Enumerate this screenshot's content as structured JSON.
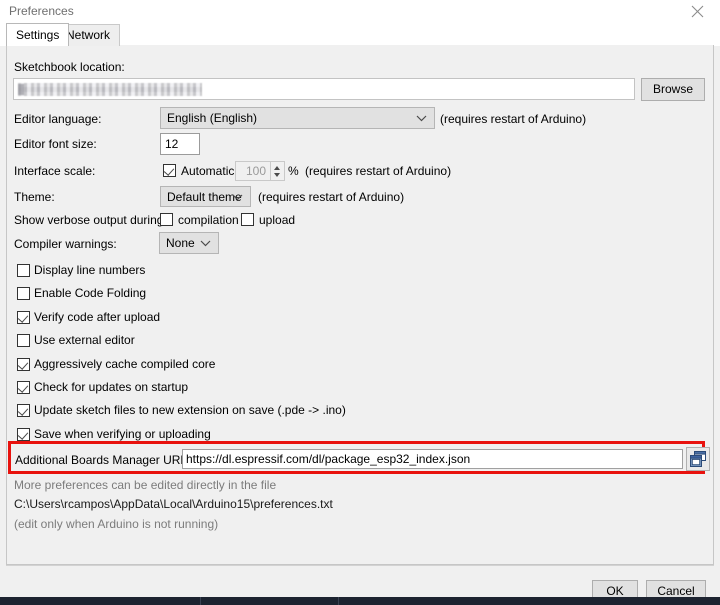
{
  "window": {
    "title": "Preferences",
    "close_icon": "close-icon"
  },
  "tabs": [
    {
      "label": "Settings",
      "active": true
    },
    {
      "label": "Network",
      "active": false
    }
  ],
  "settings": {
    "sketchbook": {
      "label": "Sketchbook location:",
      "value": "",
      "redacted": true,
      "browse_label": "Browse"
    },
    "editor_language": {
      "label": "Editor language:",
      "value": "English (English)",
      "note": "(requires restart of Arduino)"
    },
    "editor_font_size": {
      "label": "Editor font size:",
      "value": "12"
    },
    "interface_scale": {
      "label": "Interface scale:",
      "automatic_label": "Automatic",
      "automatic_checked": true,
      "scale_value": "100",
      "percent_symbol": "%",
      "note": "(requires restart of Arduino)"
    },
    "theme": {
      "label": "Theme:",
      "value": "Default theme",
      "note": "(requires restart of Arduino)"
    },
    "verbose_output": {
      "label": "Show verbose output during:",
      "options": [
        {
          "label": "compilation",
          "checked": false
        },
        {
          "label": "upload",
          "checked": false
        }
      ]
    },
    "compiler_warnings": {
      "label": "Compiler warnings:",
      "value": "None"
    },
    "checkbox_options": [
      {
        "label": "Display line numbers",
        "checked": false
      },
      {
        "label": "Enable Code Folding",
        "checked": false
      },
      {
        "label": "Verify code after upload",
        "checked": true
      },
      {
        "label": "Use external editor",
        "checked": false
      },
      {
        "label": "Aggressively cache compiled core",
        "checked": true
      },
      {
        "label": "Check for updates on startup",
        "checked": true
      },
      {
        "label": "Update sketch files to new extension on save (.pde -> .ino)",
        "checked": true
      },
      {
        "label": "Save when verifying or uploading",
        "checked": true
      }
    ],
    "additional_urls": {
      "label": "Additional Boards Manager URLs:",
      "value": "https://dl.espressif.com/dl/package_esp32_index.json",
      "expand_button_icon": "open-window-icon",
      "highlight_color": "#e8120e"
    },
    "footer": {
      "line1": "More preferences can be edited directly in the file",
      "line2": "C:\\Users\\rcampos\\AppData\\Local\\Arduino15\\preferences.txt",
      "line3": "(edit only when Arduino is not running)"
    }
  },
  "buttons": {
    "ok": "OK",
    "cancel": "Cancel"
  }
}
